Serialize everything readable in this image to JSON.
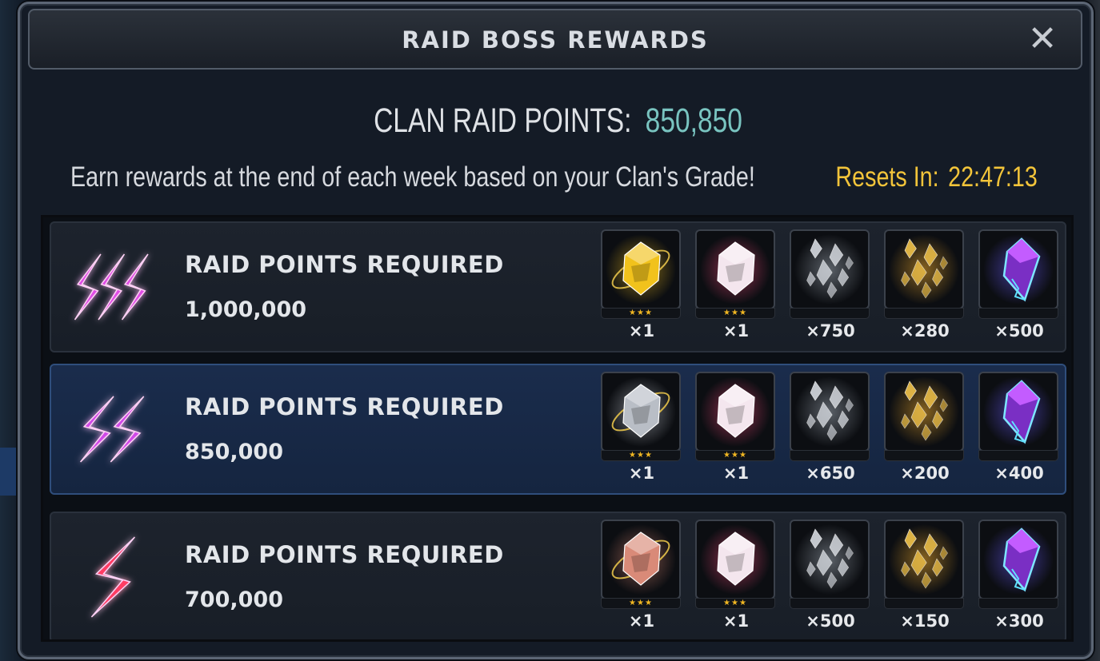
{
  "window": {
    "title": "RAID BOSS REWARDS",
    "close_glyph": "✕"
  },
  "summary": {
    "points_label": "CLAN RAID POINTS:",
    "points_value": "850,850",
    "description": "Earn rewards at the end of each week based on your Clan's Grade!",
    "resets_label": "Resets In:",
    "resets_value": "22:47:13"
  },
  "tiers": [
    {
      "grade": "SSS",
      "grade_color": "#e04ee6",
      "requirement_label": "RAID POINTS REQUIRED",
      "requirement_value": "1,000,000",
      "selected": false,
      "rewards": [
        {
          "icon": "gold-crystal-icon",
          "stars": "★★★",
          "quantity": "×1"
        },
        {
          "icon": "pink-crystal-icon",
          "stars": "★★★",
          "quantity": "×1"
        },
        {
          "icon": "silver-shards-icon",
          "stars": "",
          "quantity": "×750"
        },
        {
          "icon": "gold-shards-icon",
          "stars": "",
          "quantity": "×280"
        },
        {
          "icon": "blue-purple-crystal-icon",
          "stars": "",
          "quantity": "×500"
        }
      ]
    },
    {
      "grade": "SS",
      "grade_color": "#d048e8",
      "requirement_label": "RAID POINTS REQUIRED",
      "requirement_value": "850,000",
      "selected": true,
      "rewards": [
        {
          "icon": "silver-crystal-icon",
          "stars": "★★★",
          "quantity": "×1"
        },
        {
          "icon": "pink-crystal-icon",
          "stars": "★★★",
          "quantity": "×1"
        },
        {
          "icon": "silver-shards-icon",
          "stars": "",
          "quantity": "×650"
        },
        {
          "icon": "gold-shards-icon",
          "stars": "",
          "quantity": "×200"
        },
        {
          "icon": "blue-purple-crystal-icon",
          "stars": "",
          "quantity": "×400"
        }
      ]
    },
    {
      "grade": "S",
      "grade_color": "#ff3c64",
      "requirement_label": "RAID POINTS REQUIRED",
      "requirement_value": "700,000",
      "selected": false,
      "rewards": [
        {
          "icon": "bronze-crystal-icon",
          "stars": "★★★",
          "quantity": "×1"
        },
        {
          "icon": "pink-crystal-icon",
          "stars": "★★★",
          "quantity": "×1"
        },
        {
          "icon": "silver-shards-icon",
          "stars": "",
          "quantity": "×500"
        },
        {
          "icon": "gold-shards-icon",
          "stars": "",
          "quantity": "×150"
        },
        {
          "icon": "blue-purple-crystal-icon",
          "stars": "",
          "quantity": "×300"
        }
      ]
    }
  ]
}
